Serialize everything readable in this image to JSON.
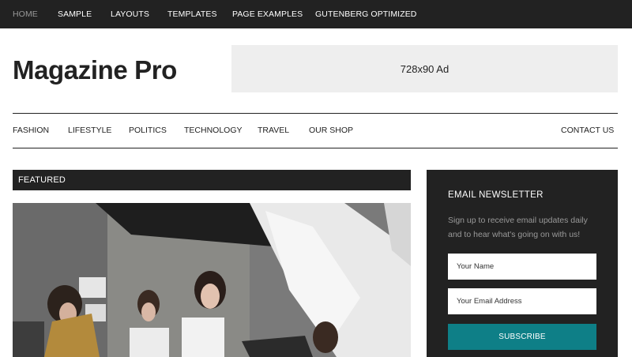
{
  "top_nav": {
    "items": [
      {
        "label": "HOME",
        "active": true
      },
      {
        "label": "SAMPLE"
      },
      {
        "label": "LAYOUTS"
      },
      {
        "label": "TEMPLATES"
      },
      {
        "label": "PAGE EXAMPLES"
      },
      {
        "label": "GUTENBERG OPTIMIZED"
      }
    ]
  },
  "header": {
    "site_title": "Magazine Pro",
    "ad_label": "728x90 Ad"
  },
  "secondary_nav": {
    "items": [
      {
        "label": "FASHION"
      },
      {
        "label": "LIFESTYLE"
      },
      {
        "label": "POLITICS"
      },
      {
        "label": "TECHNOLOGY"
      },
      {
        "label": "TRAVEL"
      },
      {
        "label": "OUR SHOP"
      }
    ],
    "contact_label": "CONTACT US"
  },
  "featured": {
    "title": "FEATURED"
  },
  "newsletter": {
    "title": "EMAIL NEWSLETTER",
    "description": "Sign up to receive email updates daily and to hear what's going on with us!",
    "name_placeholder": "Your Name",
    "email_placeholder": "Your Email Address",
    "button_label": "SUBSCRIBE"
  },
  "colors": {
    "dark": "#222222",
    "ad_bg": "#eeeeee",
    "accent": "#0e7f87"
  }
}
